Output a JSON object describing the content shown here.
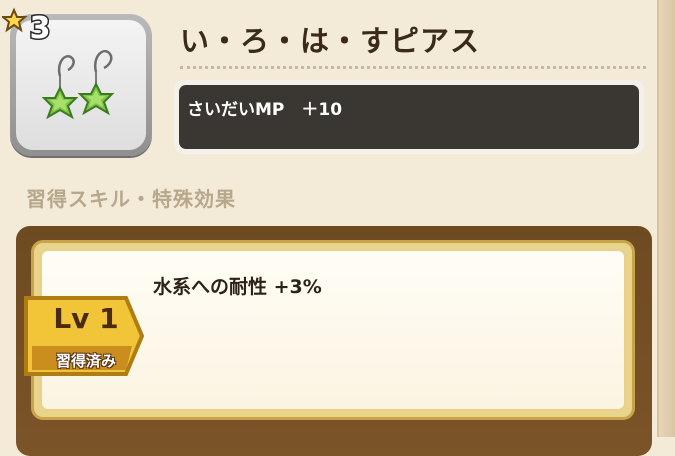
{
  "item": {
    "rarity": "3",
    "name": "い・ろ・は・すピアス",
    "icon": "green-star-earrings-icon",
    "stats": "さいだいMP　＋10"
  },
  "skills": {
    "section_title": "習得スキル・特殊効果",
    "entries": [
      {
        "level_label": "Lv 1",
        "status": "習得済み",
        "effect": "水系への耐性 +3%"
      }
    ]
  },
  "colors": {
    "background": "#f3ead8",
    "stats_box": "#3a3632",
    "frame": "#6e4a22",
    "badge_gold": "#f2c437"
  }
}
